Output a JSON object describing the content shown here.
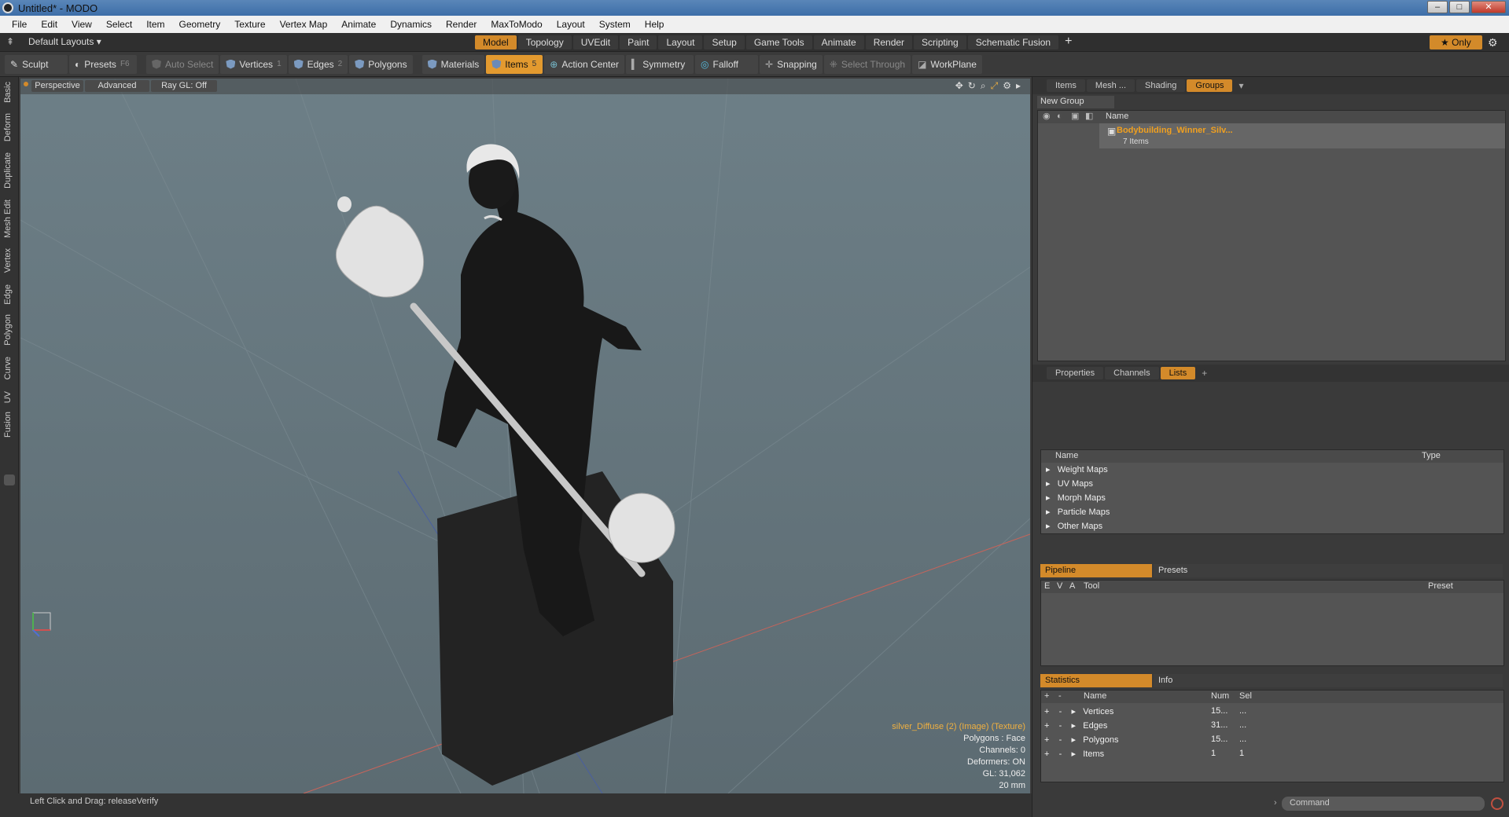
{
  "window": {
    "title": "Untitled* - MODO",
    "minimize": "–",
    "maximize": "□",
    "close": "✕"
  },
  "menu": [
    "File",
    "Edit",
    "View",
    "Select",
    "Item",
    "Geometry",
    "Texture",
    "Vertex Map",
    "Animate",
    "Dynamics",
    "Render",
    "MaxToModo",
    "Layout",
    "System",
    "Help"
  ],
  "layout_selector": "Default Layouts ▾",
  "tabs": [
    {
      "label": "Model",
      "active": true
    },
    {
      "label": "Topology"
    },
    {
      "label": "UVEdit"
    },
    {
      "label": "Paint"
    },
    {
      "label": "Layout"
    },
    {
      "label": "Setup"
    },
    {
      "label": "Game Tools"
    },
    {
      "label": "Animate"
    },
    {
      "label": "Render"
    },
    {
      "label": "Scripting"
    },
    {
      "label": "Schematic Fusion"
    }
  ],
  "tabs_add": "+",
  "only_label": "★  Only",
  "toolbar": {
    "sculpt": "Sculpt",
    "presets": "Presets",
    "presets_key": "F6",
    "auto_select": "Auto Select",
    "vertices": "Vertices",
    "vertices_key": "1",
    "edges": "Edges",
    "edges_key": "2",
    "polygons": "Polygons",
    "materials": "Materials",
    "items": "Items",
    "items_key": "5",
    "action_center": "Action Center",
    "symmetry": "Symmetry",
    "falloff": "Falloff",
    "snapping": "Snapping",
    "select_through": "Select Through",
    "workplane": "WorkPlane"
  },
  "left_tabs": [
    "Basic",
    "Deform",
    "Duplicate",
    "Mesh Edit",
    "Vertex",
    "Edge",
    "Polygon",
    "Curve",
    "UV",
    "Fusion"
  ],
  "viewport": {
    "perspective": "Perspective",
    "advanced": "Advanced",
    "raygl": "Ray GL: Off",
    "info": {
      "texture": "silver_Diffuse (2) (Image) (Texture)",
      "polygons": "Polygons : Face",
      "channels": "Channels: 0",
      "deformers": "Deformers: ON",
      "gl": "GL: 31,062",
      "scale": "20 mm"
    }
  },
  "status": "Left Click and Drag:  releaseVerify",
  "right": {
    "top_tabs": [
      {
        "label": "Items"
      },
      {
        "label": "Mesh ..."
      },
      {
        "label": "Shading"
      },
      {
        "label": "Groups",
        "active": true
      }
    ],
    "new_group": "New Group",
    "name_col": "Name",
    "group_name": "Bodybuilding_Winner_Silv...",
    "group_count": "7 Items",
    "mid_tabs": [
      {
        "label": "Properties"
      },
      {
        "label": "Channels"
      },
      {
        "label": "Lists",
        "active": true
      }
    ],
    "lists_cols": {
      "name": "Name",
      "type": "Type"
    },
    "lists": [
      "Weight Maps",
      "UV Maps",
      "Morph Maps",
      "Particle Maps",
      "Other Maps"
    ],
    "pipeline": "Pipeline",
    "presets": "Presets",
    "pipe_cols": {
      "e": "E",
      "v": "V",
      "a": "A",
      "tool": "Tool",
      "preset": "Preset"
    },
    "statistics": "Statistics",
    "info": "Info",
    "stat_cols": {
      "name": "Name",
      "num": "Num",
      "sel": "Sel"
    },
    "stats": [
      {
        "name": "Vertices",
        "num": "15...",
        "sel": "..."
      },
      {
        "name": "Edges",
        "num": "31...",
        "sel": "..."
      },
      {
        "name": "Polygons",
        "num": "15...",
        "sel": "..."
      },
      {
        "name": "Items",
        "num": "1",
        "sel": "1"
      }
    ],
    "command_placeholder": "Command"
  }
}
